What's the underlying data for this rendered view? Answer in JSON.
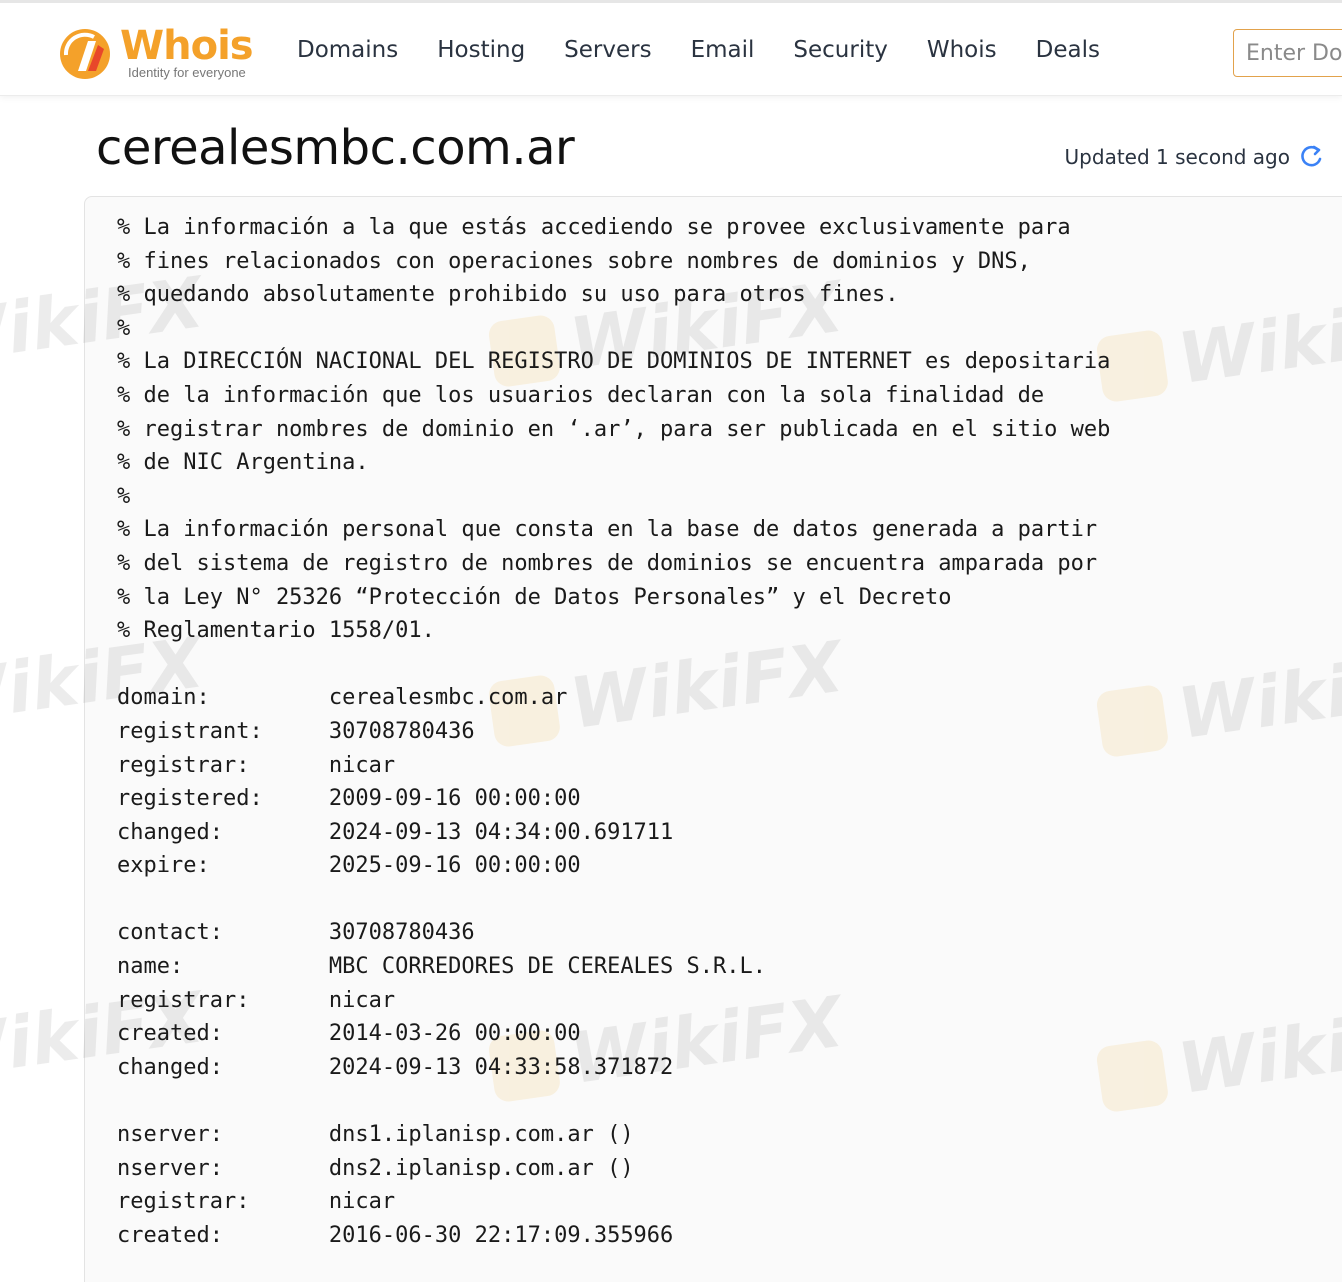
{
  "header": {
    "logo": {
      "text": "Whois",
      "tagline": "Identity for everyone"
    },
    "nav": [
      "Domains",
      "Hosting",
      "Servers",
      "Email",
      "Security",
      "Whois",
      "Deals"
    ],
    "search": {
      "placeholder": "Enter Domain"
    }
  },
  "main": {
    "domain": "cerealesmbc.com.ar",
    "updated": "Updated 1 second ago",
    "whois_lines": [
      "% La información a la que estás accediendo se provee exclusivamente para",
      "% fines relacionados con operaciones sobre nombres de dominios y DNS,",
      "% quedando absolutamente prohibido su uso para otros fines.",
      "%",
      "% La DIRECCIÓN NACIONAL DEL REGISTRO DE DOMINIOS DE INTERNET es depositaria",
      "% de la información que los usuarios declaran con la sola finalidad de",
      "% registrar nombres de dominio en ‘.ar’, para ser publicada en el sitio web",
      "% de NIC Argentina.",
      "%",
      "% La información personal que consta en la base de datos generada a partir",
      "% del sistema de registro de nombres de dominios se encuentra amparada por",
      "% la Ley N° 25326 “Protección de Datos Personales” y el Decreto",
      "% Reglamentario 1558/01.",
      "",
      "domain:         cerealesmbc.com.ar",
      "registrant:     30708780436",
      "registrar:      nicar",
      "registered:     2009-09-16 00:00:00",
      "changed:        2024-09-13 04:34:00.691711",
      "expire:         2025-09-16 00:00:00",
      "",
      "contact:        30708780436",
      "name:           MBC CORREDORES DE CEREALES S.R.L.",
      "registrar:      nicar",
      "created:        2014-03-26 00:00:00",
      "changed:        2024-09-13 04:33:58.371872",
      "",
      "nserver:        dns1.iplanisp.com.ar ()",
      "nserver:        dns2.iplanisp.com.ar ()",
      "registrar:      nicar",
      "created:        2016-06-30 22:17:09.355966"
    ]
  },
  "watermark": {
    "text": "WikiFX"
  },
  "colors": {
    "brand": "#f4a12a",
    "accent_border": "#e2a24c",
    "refresh": "#3b82f6"
  }
}
